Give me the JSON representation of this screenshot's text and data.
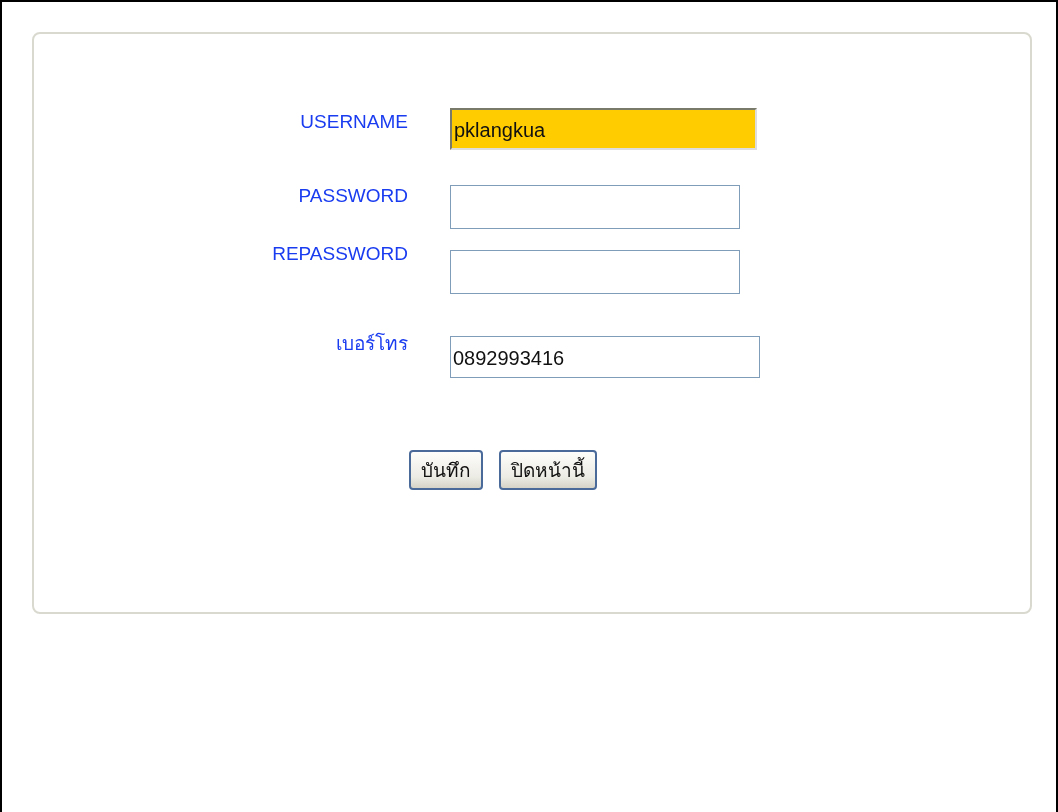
{
  "form": {
    "fields": [
      {
        "label": "USERNAME",
        "kind": "text",
        "value": "pklangkua",
        "focused": true
      },
      {
        "label": "PASSWORD",
        "kind": "password",
        "focused": false
      },
      {
        "label": "REPASSWORD",
        "kind": "password",
        "focused": false
      },
      {
        "label": "เบอร์โทร",
        "kind": "text",
        "value": "0892993416",
        "focused": false
      }
    ],
    "buttons": [
      "บันทึก",
      "ปิดหน้านี้"
    ]
  }
}
